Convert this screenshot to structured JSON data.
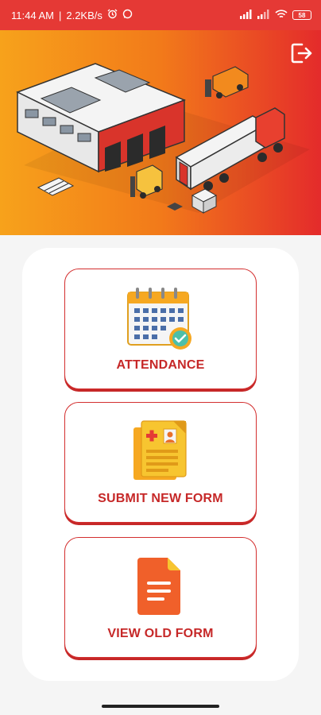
{
  "status": {
    "time": "11:44 AM",
    "net_speed": "2.2KB/s",
    "battery": "58"
  },
  "header": {
    "logout_icon": "logout-icon",
    "illustration": "warehouse-illustration"
  },
  "menu": [
    {
      "label": "ATTENDANCE",
      "icon": "calendar-check-icon"
    },
    {
      "label": "SUBMIT NEW FORM",
      "icon": "medical-form-icon"
    },
    {
      "label": "VIEW OLD FORM",
      "icon": "document-icon"
    }
  ],
  "colors": {
    "accent": "#c62828",
    "status_bar": "#e53935",
    "hero_start": "#f7a21b",
    "hero_end": "#e42b2b"
  }
}
